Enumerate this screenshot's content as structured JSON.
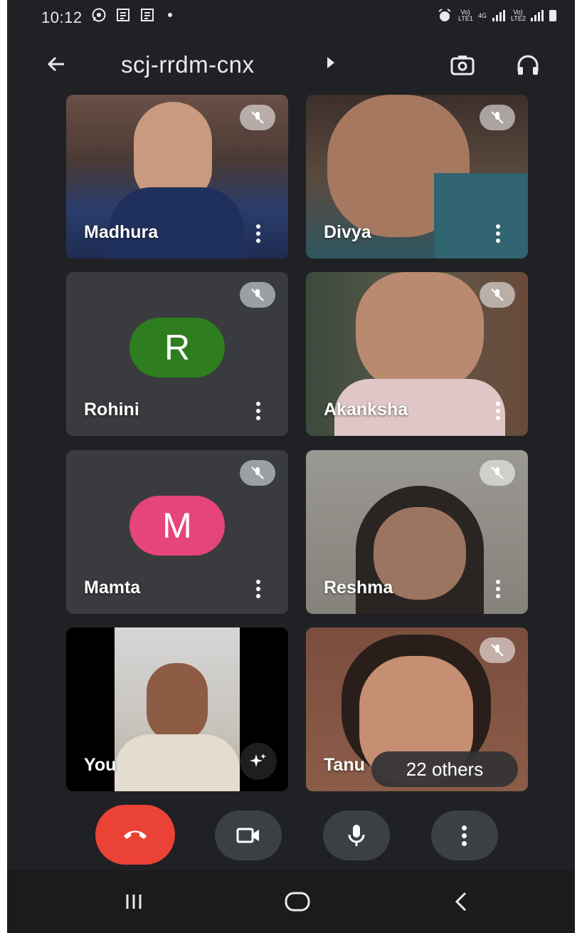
{
  "status_bar": {
    "time": "10:12",
    "net_label_1": "Vo) LTE1",
    "net_label_2": "4G",
    "net_label_3": "Vo) LTE2"
  },
  "meeting": {
    "code": "scj-rrdm-cnx"
  },
  "participants": [
    {
      "name": "Madhura",
      "type": "video",
      "muted": true
    },
    {
      "name": "Divya",
      "type": "video",
      "muted": true
    },
    {
      "name": "Rohini",
      "type": "avatar",
      "initial": "R",
      "avatar_color": "#2e7d1e",
      "muted": true
    },
    {
      "name": "Akanksha",
      "type": "video",
      "muted": true
    },
    {
      "name": "Mamta",
      "type": "avatar",
      "initial": "M",
      "avatar_color": "#e6457a",
      "muted": true
    },
    {
      "name": "Reshma",
      "type": "video",
      "muted": true
    },
    {
      "name": "You",
      "type": "video",
      "muted": false
    },
    {
      "name": "Tanu",
      "type": "video",
      "muted": true
    }
  ],
  "others_badge": "22 others",
  "colors": {
    "background": "#202124",
    "end_call": "#ea4335",
    "control": "#3c4043"
  },
  "icons": [
    "back-arrow-icon",
    "switch-camera-icon",
    "headphones-icon",
    "mic-off-icon",
    "more-vert-icon",
    "effects-sparkle-icon",
    "end-call-icon",
    "camera-icon",
    "mic-icon",
    "recents-icon",
    "home-icon",
    "nav-back-icon"
  ]
}
